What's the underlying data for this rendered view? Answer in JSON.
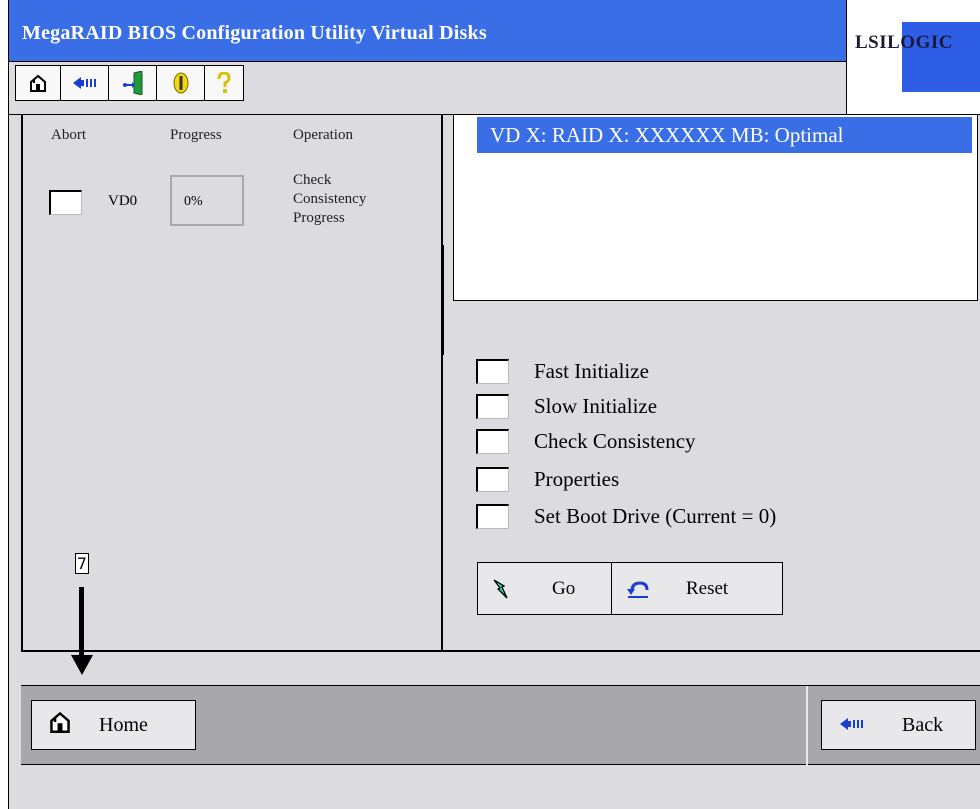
{
  "window": {
    "title": "MegaRAID BIOS Configuration Utility Virtual Disks",
    "logo": "LSILOGIC"
  },
  "toolbar": {
    "buttons": [
      {
        "icon": "home-icon"
      },
      {
        "icon": "back-arrow-icon"
      },
      {
        "icon": "exit-door-icon"
      },
      {
        "icon": "info-icon"
      },
      {
        "icon": "help-icon"
      }
    ]
  },
  "progress_panel": {
    "headers": {
      "abort": "Abort",
      "progress": "Progress",
      "operation": "Operation"
    },
    "rows": [
      {
        "vd": "VD0",
        "progress": "0%",
        "operation_lines": [
          "Check",
          "Consistency",
          "Progress"
        ]
      }
    ]
  },
  "vd_list": {
    "items": [
      "VD X: RAID X: XXXXXX MB: Optimal"
    ],
    "selected_index": 0
  },
  "options": [
    "Fast Initialize",
    "Slow Initialize",
    "Check Consistency",
    "Properties",
    "Set Boot Drive (Current = 0)"
  ],
  "actions": {
    "go_label": "Go",
    "reset_label": "Reset"
  },
  "bottom_nav": {
    "home_label": "Home",
    "back_label": "Back"
  },
  "annotation": {
    "number": "7"
  },
  "colors": {
    "title_blue": "#3a6ee6",
    "panel_gray": "#dcdbdf",
    "bottom_bar_gray": "#a8a7ab"
  }
}
